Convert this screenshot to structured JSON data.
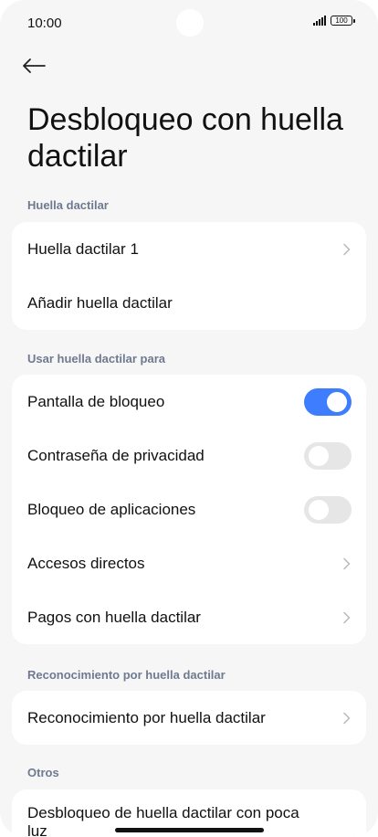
{
  "status": {
    "time": "10:00",
    "battery": "100"
  },
  "title": "Desbloqueo con huella dactilar",
  "sections": {
    "fingerprint": {
      "header": "Huella dactilar",
      "items": [
        "Huella dactilar 1",
        "Añadir huella dactilar"
      ]
    },
    "use_for": {
      "header": "Usar huella dactilar para",
      "items": [
        {
          "label": "Pantalla de bloqueo",
          "toggle": true
        },
        {
          "label": "Contraseña de privacidad",
          "toggle": false
        },
        {
          "label": "Bloqueo de aplicaciones",
          "toggle": false
        },
        {
          "label": "Accesos directos"
        },
        {
          "label": "Pagos con huella dactilar"
        }
      ]
    },
    "recognition": {
      "header": "Reconocimiento por huella dactilar",
      "items": [
        "Reconocimiento por huella dactilar"
      ]
    },
    "others": {
      "header": "Otros",
      "items": [
        "Desbloqueo de huella dactilar con poca luz"
      ]
    }
  },
  "icons": {
    "back": "arrow-left-icon",
    "chevron": "chevron-right-icon",
    "signal": "signal-icon",
    "battery": "battery-icon"
  },
  "colors": {
    "accent": "#3f7dff",
    "background": "#f6f6f6",
    "card": "#ffffff",
    "section_header": "#6f7a90",
    "toggle_off": "#e6e6e6"
  }
}
